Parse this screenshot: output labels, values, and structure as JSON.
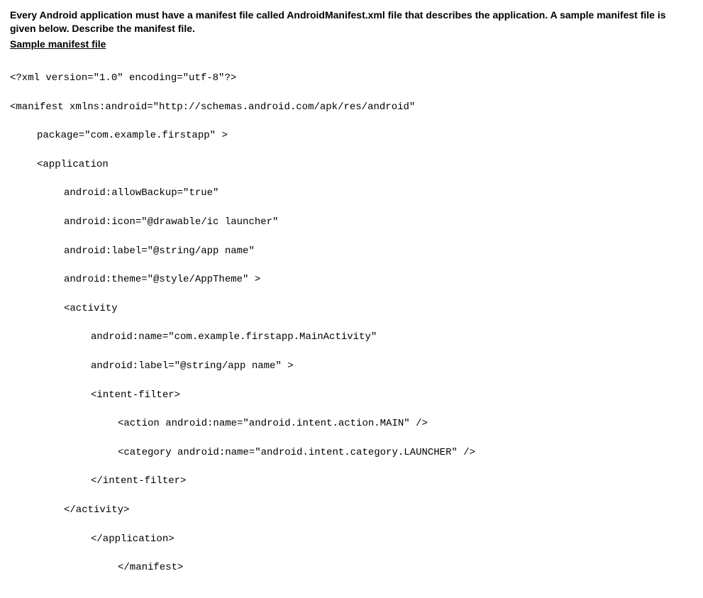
{
  "intro": "Every Android application must have a manifest file called AndroidManifest.xml file that describes the application. A sample manifest file is given below. Describe the manifest file.",
  "subhead": "Sample manifest file",
  "code": {
    "l0": "<?xml version=\"1.0\" encoding=\"utf-8\"?>",
    "l1": "<manifest xmlns:android=\"http://schemas.android.com/apk/res/android\"",
    "l2": "package=\"com.example.firstapp\" >",
    "l3": "<application",
    "l4": "android:allowBackup=\"true\"",
    "l5": "android:icon=\"@drawable/ic launcher\"",
    "l6": "android:label=\"@string/app name\"",
    "l7": "android:theme=\"@style/AppTheme\" >",
    "l8": "<activity",
    "l9": "android:name=\"com.example.firstapp.MainActivity\"",
    "l10": "android:label=\"@string/app name\" >",
    "l11": "<intent-filter>",
    "l12": "<action android:name=\"android.intent.action.MAIN\" />",
    "l13": "<category android:name=\"android.intent.category.LAUNCHER\" />",
    "l14": "</intent-filter>",
    "l15": "</activity>",
    "l16": "</application>",
    "l17": "</manifest>"
  }
}
